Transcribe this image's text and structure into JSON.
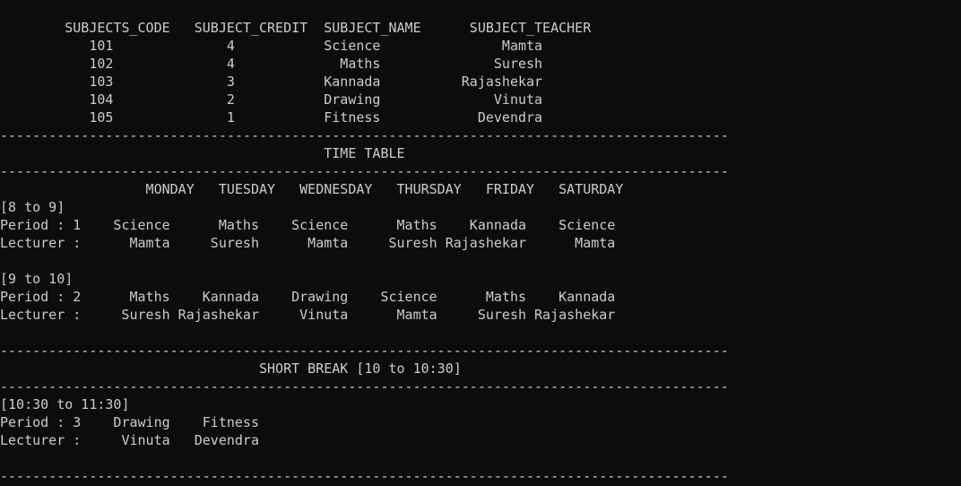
{
  "console": {
    "lines": [
      "        SUBJECTS_CODE   SUBJECT_CREDIT  SUBJECT_NAME      SUBJECT_TEACHER",
      "           101              4           Science               Mamta",
      "           102              4             Maths              Suresh",
      "           103              3           Kannada          Rajashekar",
      "           104              2           Drawing              Vinuta",
      "           105              1           Fitness            Devendra",
      "------------------------------------------------------------------------------------------",
      "                                        TIME TABLE",
      "------------------------------------------------------------------------------------------",
      "                  MONDAY   TUESDAY   WEDNESDAY   THURSDAY   FRIDAY   SATURDAY",
      "[8 to 9]",
      "Period : 1    Science      Maths    Science      Maths    Kannada    Science",
      "Lecturer :      Mamta     Suresh      Mamta     Suresh Rajashekar      Mamta",
      "",
      "[9 to 10]",
      "Period : 2      Maths    Kannada    Drawing    Science      Maths    Kannada",
      "Lecturer :     Suresh Rajashekar     Vinuta      Mamta     Suresh Rajashekar",
      "",
      "------------------------------------------------------------------------------------------",
      "                                SHORT BREAK [10 to 10:30]",
      "------------------------------------------------------------------------------------------",
      "[10:30 to 11:30]",
      "Period : 3    Drawing    Fitness",
      "Lecturer :     Vinuta   Devendra",
      "",
      "------------------------------------------------------------------------------------------"
    ]
  }
}
